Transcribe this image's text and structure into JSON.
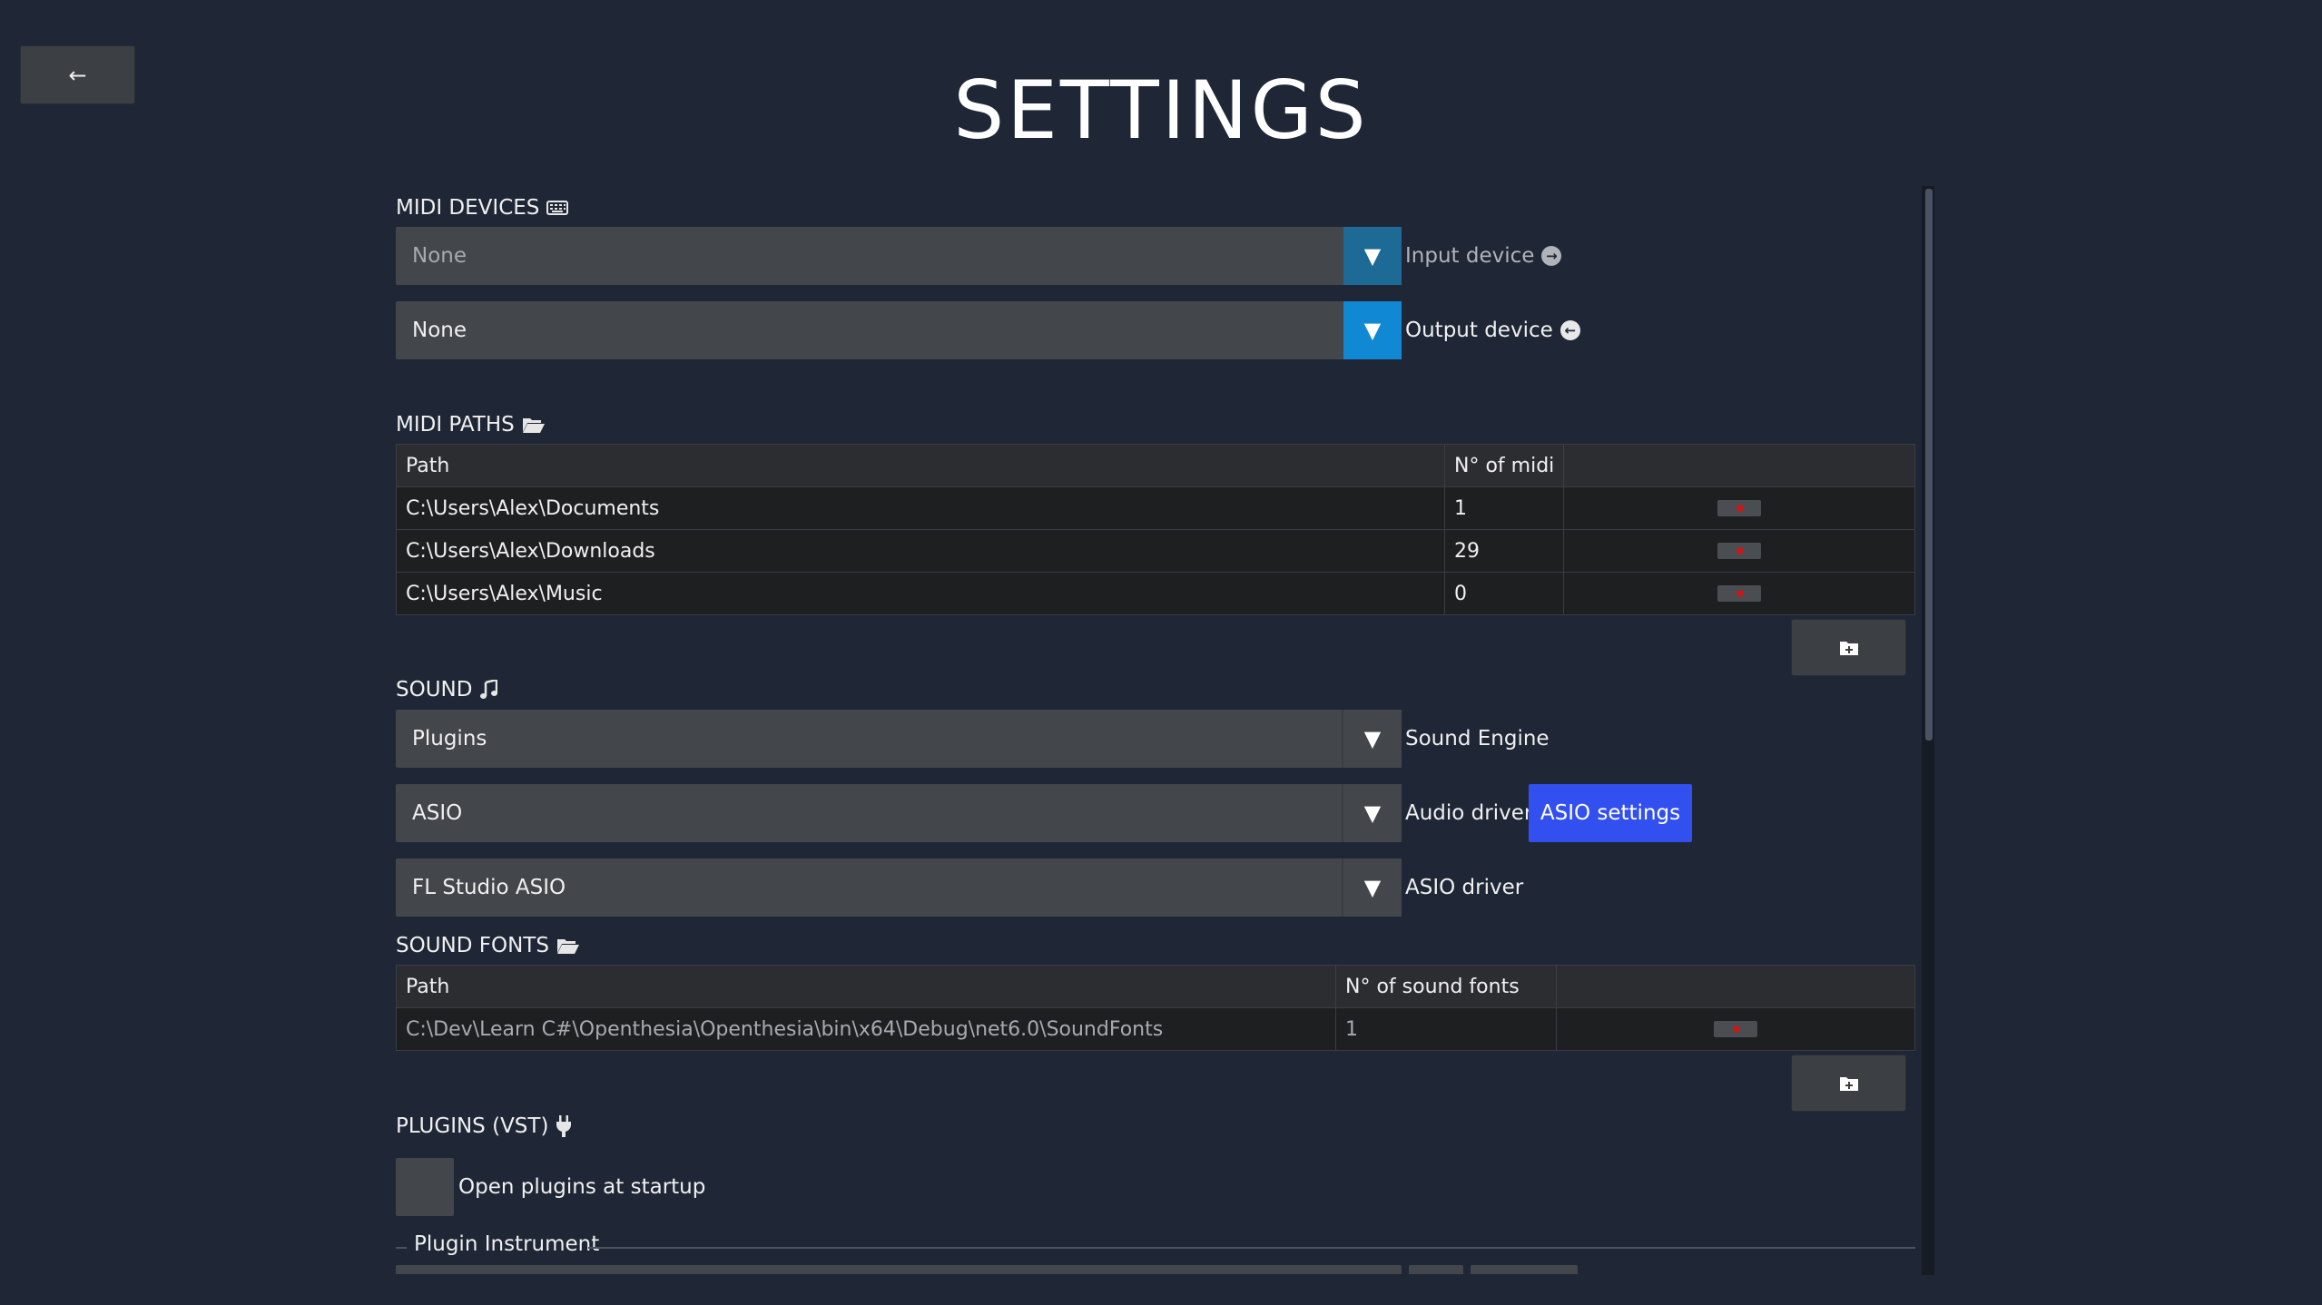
{
  "header": {
    "back_label": "←",
    "title": "SETTINGS"
  },
  "midi_devices": {
    "section_label": "MIDI DEVICES",
    "input": {
      "value": "None",
      "label": "Input device"
    },
    "output": {
      "value": "None",
      "label": "Output device"
    }
  },
  "midi_paths": {
    "section_label": "MIDI PATHS",
    "columns": [
      "Path",
      "N° of midi",
      ""
    ],
    "rows": [
      {
        "path": "C:\\Users\\Alex\\Documents",
        "count": "1"
      },
      {
        "path": "C:\\Users\\Alex\\Downloads",
        "count": "29"
      },
      {
        "path": "C:\\Users\\Alex\\Music",
        "count": "0"
      }
    ]
  },
  "sound": {
    "section_label": "SOUND",
    "engine": {
      "value": "Plugins",
      "label": "Sound Engine"
    },
    "audio_driver": {
      "value": "ASIO",
      "label": "Audio driver",
      "button": "ASIO settings"
    },
    "asio_driver": {
      "value": "FL Studio ASIO",
      "label": "ASIO driver"
    }
  },
  "sound_fonts": {
    "section_label": "SOUND FONTS",
    "columns": [
      "Path",
      "N° of sound fonts",
      ""
    ],
    "rows": [
      {
        "path": "C:\\Dev\\Learn C#\\Openthesia\\Openthesia\\bin\\x64\\Debug\\net6.0\\SoundFonts",
        "count": "1"
      }
    ]
  },
  "plugins": {
    "section_label": "PLUGINS (VST)",
    "open_at_startup_label": "Open plugins at startup",
    "instrument_group_label": "Plugin Instrument"
  },
  "colors": {
    "background": "#1f2736",
    "accent_blue": "#1088d4",
    "button_blue": "#3150ef",
    "delete_red": "#c21b1b"
  },
  "icons": {
    "back": "arrow-left-icon",
    "midi_devices": "keyboard-icon",
    "midi_paths": "folder-open-icon",
    "sound": "music-note-icon",
    "sound_fonts": "folder-open-icon",
    "plugins": "plug-icon",
    "input_device": "arrow-circle-right-icon",
    "output_device": "arrow-circle-left-icon",
    "add_folder": "folder-plus-icon"
  }
}
